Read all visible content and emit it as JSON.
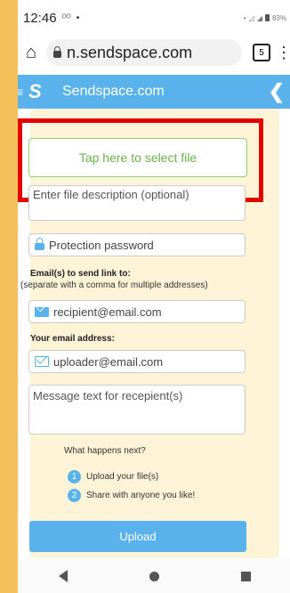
{
  "status_bar": {
    "time": "12:46",
    "battery": "83%"
  },
  "browser": {
    "url": "n.sendspace.com",
    "tab_count": "5"
  },
  "header": {
    "brand": "Sendspace.com"
  },
  "form": {
    "select_file": "Tap here to select file",
    "description_placeholder": "Enter file description (optional)",
    "password_placeholder": "Protection password",
    "recipients_label": "Email(s) to send link to:",
    "recipients_hint": "(separate with a comma for multiple addresses)",
    "recipient_placeholder": "recipient@email.com",
    "your_email_label": "Your email address:",
    "uploader_placeholder": "uploader@email.com",
    "message_placeholder": "Message text for recepient(s)",
    "next_title": "What happens next?",
    "steps": [
      {
        "num": "1",
        "text": "Upload your file(s)"
      },
      {
        "num": "2",
        "text": "Share with anyone you like!"
      }
    ],
    "upload_button": "Upload"
  }
}
